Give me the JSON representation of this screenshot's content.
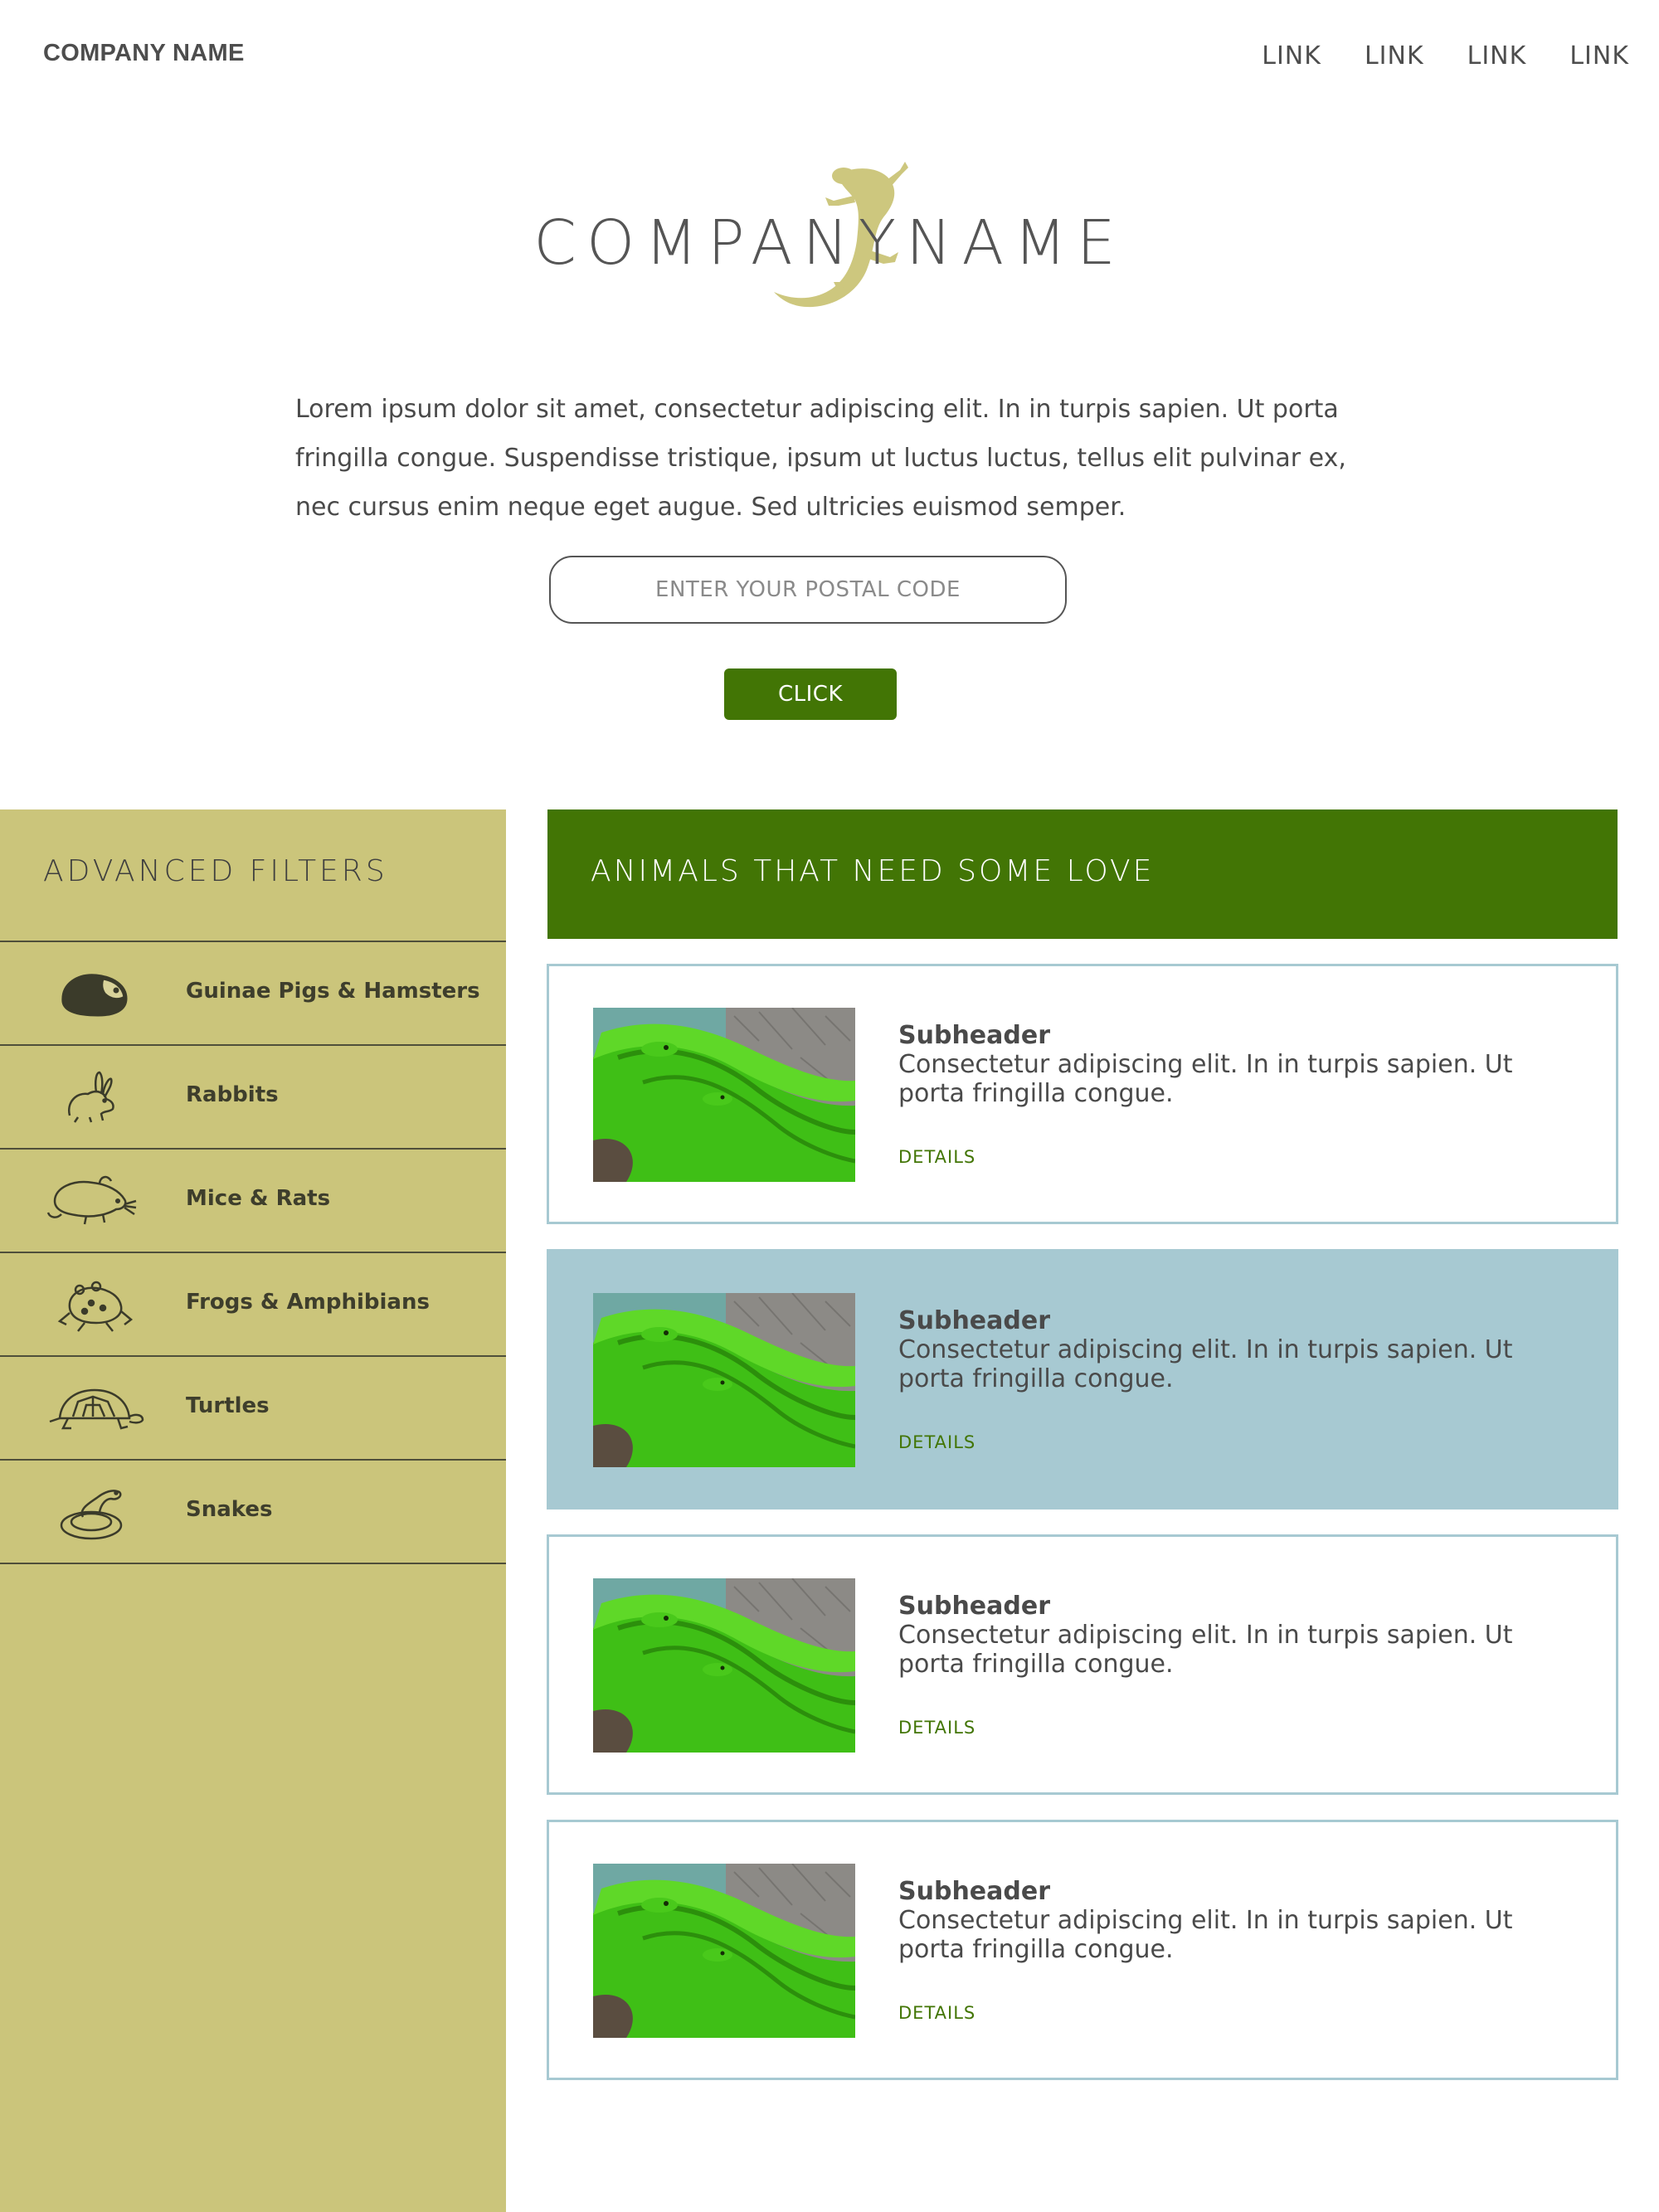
{
  "header": {
    "brand": "COMPANY NAME",
    "nav": [
      "LINK",
      "LINK",
      "LINK",
      "LINK"
    ]
  },
  "hero": {
    "logo_text": "COMPANYNAME",
    "intro": "Lorem ipsum dolor sit amet, consectetur adipiscing elit. In in turpis sapien. Ut porta fringilla congue. Suspendisse tristique, ipsum ut luctus luctus, tellus elit pulvinar ex, nec cursus enim neque eget augue. Sed ultricies euismod semper.",
    "postal_placeholder": "ENTER YOUR POSTAL CODE",
    "button_label": "CLICK"
  },
  "sidebar": {
    "title": "ADVANCED FILTERS",
    "items": [
      {
        "label": "Guinae Pigs & Hamsters",
        "icon": "guinea-pig-icon"
      },
      {
        "label": "Rabbits",
        "icon": "rabbit-icon"
      },
      {
        "label": "Mice & Rats",
        "icon": "mouse-icon"
      },
      {
        "label": "Frogs & Amphibians",
        "icon": "frog-icon"
      },
      {
        "label": "Turtles",
        "icon": "turtle-icon"
      },
      {
        "label": "Snakes",
        "icon": "snake-icon"
      }
    ]
  },
  "main": {
    "title": "ANIMALS THAT NEED SOME LOVE",
    "cards": [
      {
        "subheader": "Subheader",
        "text": "Consectetur adipiscing elit. In in turpis sapien. Ut porta fringilla congue.",
        "link": "DETAILS"
      },
      {
        "subheader": "Subheader",
        "text": "Consectetur adipiscing elit. In in turpis sapien. Ut porta fringilla congue.",
        "link": "DETAILS"
      },
      {
        "subheader": "Subheader",
        "text": "Consectetur adipiscing elit. In in turpis sapien. Ut porta fringilla congue.",
        "link": "DETAILS"
      },
      {
        "subheader": "Subheader",
        "text": "Consectetur adipiscing elit. In in turpis sapien. Ut porta fringilla congue.",
        "link": "DETAILS"
      }
    ]
  },
  "colors": {
    "accent_green": "#427505",
    "sidebar_olive": "#cbc57b",
    "card_border_blue": "#a7c9d2",
    "gecko_gold": "#cdc77e"
  }
}
